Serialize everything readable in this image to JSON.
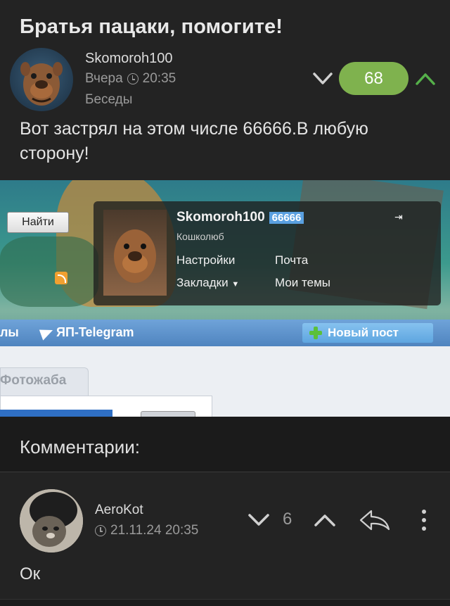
{
  "post": {
    "title": "Братья пацаки, помогите!",
    "author": "Skomoroh100",
    "date": "Вчера",
    "time": "20:35",
    "community": "Беседы",
    "rating": "68",
    "text": "Вот застрял на этом числе 66666.В любую сторону!"
  },
  "screenshot": {
    "login_label": "Найти",
    "profile_name": "Skomoroh100",
    "profile_rating": "66666",
    "profile_status": "Кошколюб",
    "settings_link": "Настройки",
    "mail_link": "Почта",
    "bookmarks_link": "Закладки",
    "my_topics_link": "Мои темы",
    "menu_left": "лы",
    "telegram_label": "ЯП-Telegram",
    "new_post_label": "Новый пост",
    "tab_label": "Фотожаба"
  },
  "comments": {
    "title": "Комментарии:",
    "items": [
      {
        "author": "AeroKot",
        "date": "21.11.24 20:35",
        "score": "6",
        "text": "Ок"
      }
    ]
  },
  "colors": {
    "background": "#1b1b1b",
    "card": "#232323",
    "rating_green": "#7fb24e",
    "vote_up_green": "#55b04a",
    "muted_text": "#9a9a9a"
  },
  "icons": [
    "clock-icon",
    "chevron-down-icon",
    "chevron-up-icon",
    "reply-icon",
    "more-vertical-icon",
    "plus-icon",
    "telegram-icon",
    "rss-icon",
    "exit-icon"
  ]
}
